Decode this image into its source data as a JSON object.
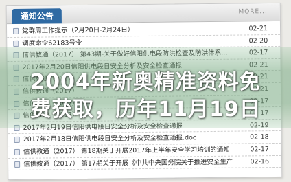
{
  "header": {
    "tab_label": "通知公告",
    "more_label": "MORE..."
  },
  "notices": [
    {
      "title": "党群周工作提示（2月20日-2月24日）",
      "date": "02-21"
    },
    {
      "title": "调度命令62183号令",
      "date": "02-20"
    },
    {
      "title": "信供教通（2017） 第43期-关于做好信阳供电段防洪检查及防洪体系...",
      "date": "02-17"
    },
    {
      "title": "2017年2月20日信阳供电段日安全分析及安全检查通报",
      "date": "02-21"
    },
    {
      "title": "信供教通（2017）",
      "date": "02-21"
    },
    {
      "title": "信供教通（2017）",
      "date": "02-21"
    },
    {
      "title": "信供教通（2017）",
      "date": "02-17"
    },
    {
      "title": "信供教通（2017）",
      "date": "02-17"
    },
    {
      "title": "2017年2月19日信阳供电段日安全分析及安全检查通报",
      "date": "02-19"
    },
    {
      "title": "2017年2月18日信阳供电段日安全分析及安全检查通报.doc",
      "date": "02-18"
    },
    {
      "title": "信供教通（2017） 第18期关于开展2017年上半年安全学习培训的通知",
      "date": "02-17"
    },
    {
      "title": "信供教通（2017） 第17期关于开展《中共中央国务院关于推进安全生产...",
      "date": "02-16"
    }
  ],
  "overlay": {
    "line1": "2004年新奥精准资料免",
    "line2": "费获取，历年11月19日"
  }
}
